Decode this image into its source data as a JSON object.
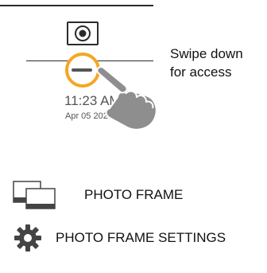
{
  "panel": {
    "camera_icon": "camera-icon"
  },
  "swipe_hint": {
    "line1": "Swipe down",
    "line2": "for access"
  },
  "clock": {
    "time": "11:23 AM",
    "date": "Apr 05 2021"
  },
  "menu": {
    "items": [
      {
        "label": "PHOTO FRAME",
        "icon": "photo-frame-icon"
      },
      {
        "label": "PHOTO FRAME SETTINGS",
        "icon": "gear-icon"
      }
    ]
  },
  "colors": {
    "accent": "#f5a623",
    "line": "#2b2b2b",
    "hand": "#8e8e8e",
    "text": "#111111"
  }
}
